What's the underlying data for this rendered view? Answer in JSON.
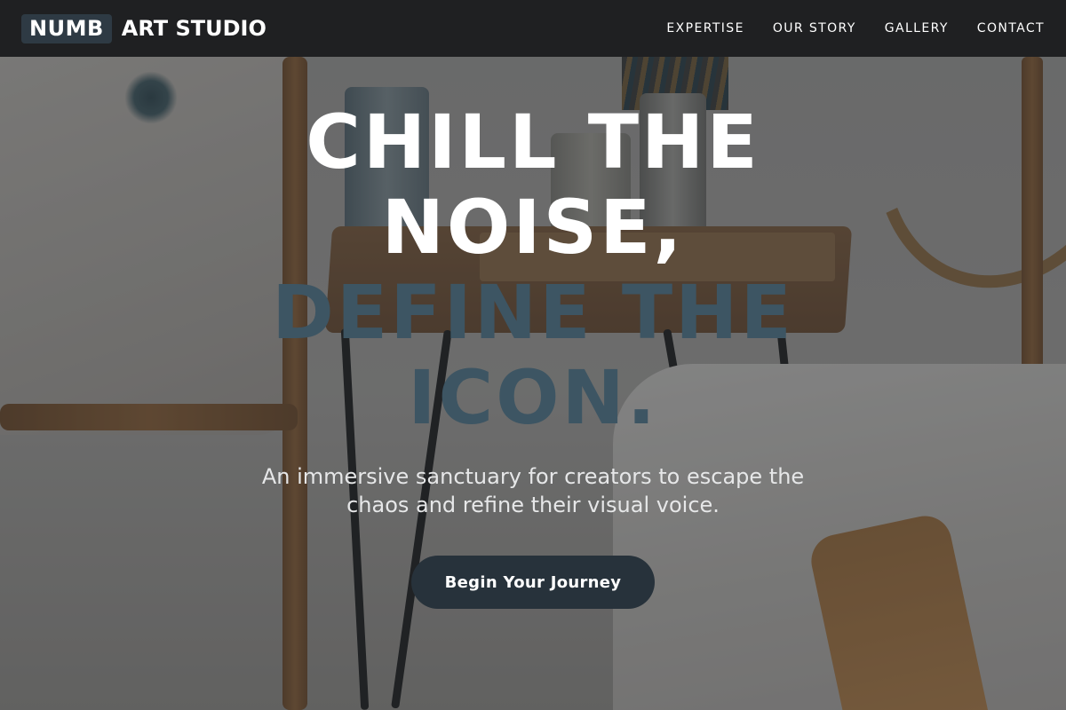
{
  "header": {
    "logo_mark": "NUMB",
    "logo_text": "ART STUDIO",
    "nav": [
      {
        "label": "EXPERTISE"
      },
      {
        "label": "OUR STORY"
      },
      {
        "label": "GALLERY"
      },
      {
        "label": "CONTACT"
      }
    ]
  },
  "hero": {
    "headline_lines": [
      "CHILL THE",
      "NOISE,",
      "DEFINE THE",
      "ICON."
    ],
    "subtext": "An immersive sanctuary for creators to escape the chaos and refine their visual voice.",
    "cta_label": "Begin Your Journey"
  },
  "colors": {
    "header_bg": "#1f2022",
    "logo_mark_bg": "#2e3a44",
    "accent_text": "#3d5563",
    "cta_bg": "#27323b"
  }
}
